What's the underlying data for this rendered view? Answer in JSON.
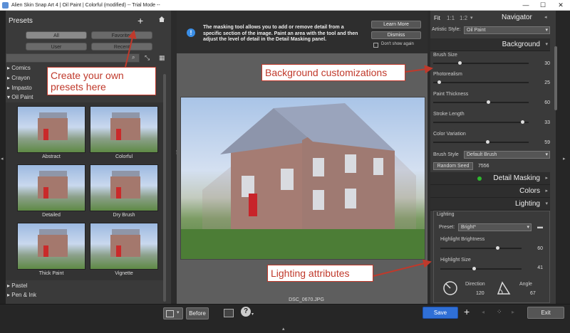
{
  "window": {
    "title": "Alien Skin Snap Art 4 | Oil Paint | Colorful (modified) -- Trial Mode --",
    "minimize": "—",
    "maximize": "☐",
    "close": "✕"
  },
  "presets_panel": {
    "title": "Presets",
    "filters": [
      "All",
      "Favorites",
      "User",
      "Recent"
    ],
    "categories_top": [
      "Comics",
      "Crayon",
      "Impasto",
      "Oil Paint"
    ],
    "thumbnails": [
      "Abstract",
      "Colorful",
      "Detailed",
      "Dry Brush",
      "Thick Paint",
      "Vignette"
    ],
    "categories_bottom": [
      "Pastel",
      "Pen & Ink"
    ]
  },
  "info_bar": {
    "icon": "!",
    "message": "The masking tool allows you to add or remove detail from a specific section of the image. Paint an area with the tool and then adjust the level of detail in the Detail Masking panel.",
    "learn_more": "Learn More",
    "dismiss": "Dismiss",
    "dont_show": "Don't show again"
  },
  "image": {
    "filename": "DSC_0670.JPG"
  },
  "navigator": {
    "zoom_fit": "Fit",
    "zoom_1_1": "1:1",
    "zoom_1_2": "1:2",
    "title": "Navigator",
    "artistic_style_label": "Artistic Style:",
    "artistic_style_value": "Oil Paint"
  },
  "background": {
    "title": "Background",
    "sliders": [
      {
        "label": "Brush Size",
        "value": "30",
        "level": 0.27
      },
      {
        "label": "Photorealism",
        "value": "25",
        "level": 0.05
      },
      {
        "label": "Paint Thickness",
        "value": "60",
        "level": 0.58
      },
      {
        "label": "Stroke Length",
        "value": "33",
        "level": 0.95
      },
      {
        "label": "Color Variation",
        "value": "59",
        "level": 0.57
      }
    ],
    "brush_style_label": "Brush Style",
    "brush_style_value": "Default Brush",
    "random_seed_label": "Random Seed",
    "random_seed_value": "7556"
  },
  "sections": {
    "detail_masking": "Detail Masking",
    "colors": "Colors",
    "lighting": "Lighting"
  },
  "lighting": {
    "group_label": "Lighting",
    "preset_label": "Preset:",
    "preset_value": "Bright*",
    "highlight_brightness_label": "Highlight Brightness",
    "highlight_brightness_value": "60",
    "highlight_brightness_level": 0.72,
    "highlight_size_label": "Highlight Size",
    "highlight_size_value": "41",
    "highlight_size_level": 0.41,
    "direction_label": "Direction",
    "direction_value": "120",
    "angle_label": "Angle",
    "angle_value": "67"
  },
  "bottom_bar": {
    "before": "Before",
    "save": "Save",
    "exit": "Exit"
  },
  "annotations": {
    "presets": "Create your own presets here",
    "background": "Background customizations",
    "lighting": "Lighting attributes"
  },
  "colors": {
    "accent": "#2f6fd6",
    "annotation": "#c0392b",
    "indicator": "#2eb82e"
  }
}
